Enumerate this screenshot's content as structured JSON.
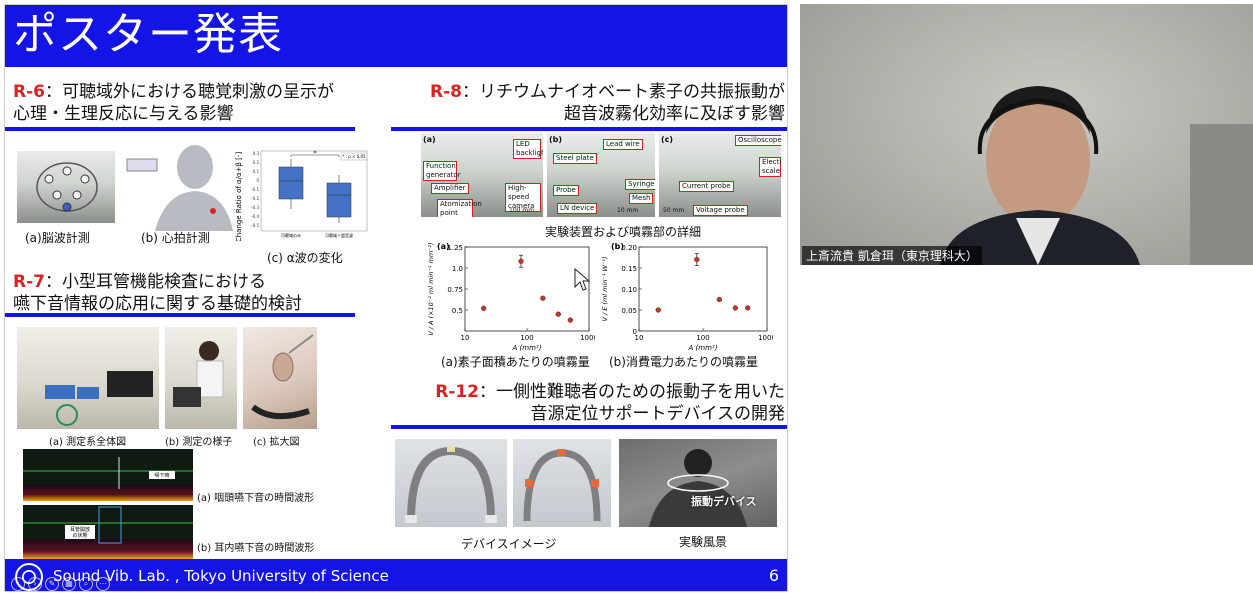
{
  "slide": {
    "title": "ポスター発表",
    "page_number": "6",
    "footer": "Sound Vib. Lab. , Tokyo University of Science",
    "r6": {
      "id": "R-6",
      "title_line1": "：可聴域外における聴覚刺激の呈示が",
      "title_line2": "心理・生理反応に与える影響",
      "cap_a": "(a)脳波計測",
      "cap_b": "(b) 心拍計測",
      "cap_c": "(c) α波の変化",
      "chart": {
        "ylabel": "Change Ratio of α/α+β [-]",
        "sig": "*",
        "legend": "* : p < 0.05",
        "yticks": [
          "0.3",
          "0.2",
          "0.1",
          "0",
          "-0.1",
          "-0.2",
          "-0.3",
          "-0.4",
          "-0.5"
        ],
        "xtick1": "可聴域のみ",
        "xtick2": "可聴域＋超音波"
      }
    },
    "r7": {
      "id": "R-7",
      "title_line1": "：小型耳管機能検査における",
      "title_line2": "嚥下音情報の応用に関する基礎的検討",
      "cap_a": "(a) 測定系全体図",
      "cap_b": "(b) 測定の様子",
      "cap_c": "(c) 拡大図",
      "wave_a": "(a) 咽頭嚥下音の時間波形",
      "wave_b": "(b) 耳内嚥下音の時間波形",
      "spec_label1": "嚥下時",
      "spec_label2": "耳管開放",
      "spec_label3": "の状態"
    },
    "r8": {
      "id": "R-8",
      "title_line1": "：リチウムナイオベート素子の共振振動が",
      "title_line2": "超音波霧化効率に及ぼす影響",
      "photo_caption": "実験装置および噴霧部の詳細",
      "tags": {
        "a": "(a)",
        "b": "(b)",
        "c": "(c)",
        "led": "LED backlight",
        "function_generator": "Function generator",
        "amplifier": "Amplifier",
        "atomization_point": "Atomization point",
        "high_speed_camera": "High-speed camera",
        "scale_a": "100 mm",
        "lead_wire": "Lead wire",
        "steel_plate": "Steel plate",
        "probe": "Probe",
        "syringe": "Syringe",
        "mesh": "Mesh",
        "ln_device": "LN device",
        "scale_b": "10 mm",
        "oscilloscope": "Oscilloscope",
        "electronic_scale": "Electronic scale",
        "current_probe": "Current probe",
        "voltage_probe": "Voltage probe",
        "scale_c": "50 mm"
      },
      "cap_a": "(a)素子面積あたりの噴霧量",
      "cap_b": "(b)消費電力あたりの噴霧量"
    },
    "r12": {
      "id": "R-12",
      "title_line1": "：一側性難聴者のための振動子を用いた",
      "title_line2": "音源定位サポートデバイスの開発",
      "cap_device": "デバイスイメージ",
      "cap_scene": "実験風景",
      "device_label": "振動デバイス"
    }
  },
  "video": {
    "name_label": "上斎流貴 凱倉珥（東京理科大）"
  },
  "chart_data": [
    {
      "type": "scatter",
      "title": "",
      "panel": "(a)",
      "xlabel": "A (mm²)",
      "ylabel": "V / A (×10⁻² ml min⁻¹ mm⁻²)",
      "xscale": "log",
      "xlim": [
        10,
        1000
      ],
      "ylim": [
        0.25,
        1.25
      ],
      "xticks": [
        "10",
        "100",
        "1000"
      ],
      "yticks": [
        "0.5",
        "0.75",
        "1.0",
        "1.25"
      ],
      "x": [
        20,
        80,
        180,
        320,
        500
      ],
      "y": [
        0.52,
        1.08,
        0.64,
        0.45,
        0.38
      ],
      "error_bar_index": 1
    },
    {
      "type": "scatter",
      "title": "",
      "panel": "(b)",
      "xlabel": "A (mm²)",
      "ylabel": "V / E (ml min⁻¹ W⁻¹)",
      "xscale": "log",
      "xlim": [
        10,
        1000
      ],
      "ylim": [
        0,
        0.2
      ],
      "xticks": [
        "10",
        "100",
        "1000"
      ],
      "yticks": [
        "0",
        "0.05",
        "0.10",
        "0.15",
        "0.20"
      ],
      "x": [
        20,
        80,
        180,
        320,
        500
      ],
      "y": [
        0.05,
        0.17,
        0.075,
        0.055,
        0.055
      ],
      "error_bar_index": 1
    }
  ],
  "colors": {
    "slide_blue": "#1414e6",
    "accent_red": "#e02020",
    "marker_red": "#c0392b"
  }
}
